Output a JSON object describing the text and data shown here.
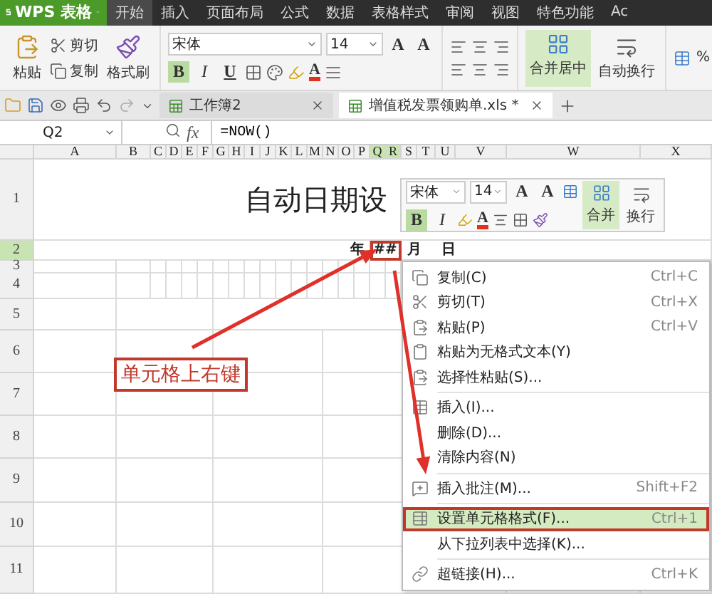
{
  "app_menu": {
    "label": "WPS 表格"
  },
  "menu_tabs": [
    {
      "label": "开始",
      "selected": true
    },
    {
      "label": "插入",
      "selected": false
    },
    {
      "label": "页面布局",
      "selected": false
    },
    {
      "label": "公式",
      "selected": false
    },
    {
      "label": "数据",
      "selected": false
    },
    {
      "label": "表格样式",
      "selected": false
    },
    {
      "label": "审阅",
      "selected": false
    },
    {
      "label": "视图",
      "selected": false
    },
    {
      "label": "特色功能",
      "selected": false
    },
    {
      "label": "Ac",
      "selected": false
    }
  ],
  "ribbon": {
    "paste": "粘贴",
    "cut": "剪切",
    "copy": "复制",
    "format_painter": "格式刷",
    "font": "宋体",
    "size": "14",
    "grow": "A",
    "shrink": "A",
    "bold": "B",
    "italic": "I",
    "underline": "U",
    "font_color": "A",
    "bold_on": true,
    "merge": "合并居中",
    "wrap": "自动换行",
    "percent": "%"
  },
  "doc_tabs": [
    {
      "title": "工作簿2",
      "selected": false
    },
    {
      "title": "增值税发票领购单.xls *",
      "selected": true
    }
  ],
  "formula_bar": {
    "cell": "Q2",
    "fx": "fx",
    "formula": "=NOW()"
  },
  "columns": [
    {
      "label": "A",
      "selected": false
    },
    {
      "label": "B",
      "selected": false
    },
    {
      "label": "C",
      "selected": false
    },
    {
      "label": "D",
      "selected": false
    },
    {
      "label": "E",
      "selected": false
    },
    {
      "label": "F",
      "selected": false
    },
    {
      "label": "G",
      "selected": false
    },
    {
      "label": "H",
      "selected": false
    },
    {
      "label": "I",
      "selected": false
    },
    {
      "label": "J",
      "selected": false
    },
    {
      "label": "K",
      "selected": false
    },
    {
      "label": "L",
      "selected": false
    },
    {
      "label": "M",
      "selected": false
    },
    {
      "label": "N",
      "selected": false
    },
    {
      "label": "O",
      "selected": false
    },
    {
      "label": "P",
      "selected": false
    },
    {
      "label": "Q",
      "selected": true
    },
    {
      "label": "R",
      "selected": true
    },
    {
      "label": "S",
      "selected": false
    },
    {
      "label": "T",
      "selected": false
    },
    {
      "label": "U",
      "selected": false
    },
    {
      "label": "V",
      "selected": false
    },
    {
      "label": "W",
      "selected": false
    },
    {
      "label": "X",
      "selected": false
    }
  ],
  "rows": [
    {
      "label": "1",
      "selected": false
    },
    {
      "label": "2",
      "selected": true
    },
    {
      "label": "3",
      "selected": false
    },
    {
      "label": "4",
      "selected": false
    },
    {
      "label": "5",
      "selected": false
    },
    {
      "label": "6",
      "selected": false
    },
    {
      "label": "7",
      "selected": false
    },
    {
      "label": "8",
      "selected": false
    },
    {
      "label": "9",
      "selected": false
    },
    {
      "label": "10",
      "selected": false
    },
    {
      "label": "11",
      "selected": false
    }
  ],
  "cells": {
    "title": "自动日期设",
    "year": "年",
    "value": "##",
    "month": "月",
    "day": "日"
  },
  "mini_toolbar": {
    "font": "宋体",
    "size": "14",
    "grow": "A",
    "shrink": "A",
    "bold": "B",
    "italic": "I",
    "font_color": "A",
    "bold_on": true,
    "merge": "合并",
    "wrap": "换行"
  },
  "context_menu": [
    {
      "kind": "item",
      "label": "复制(C)",
      "shortcut": "Ctrl+C",
      "selected": false
    },
    {
      "kind": "item",
      "label": "剪切(T)",
      "shortcut": "Ctrl+X",
      "selected": false
    },
    {
      "kind": "item",
      "label": "粘贴(P)",
      "shortcut": "Ctrl+V",
      "selected": false
    },
    {
      "kind": "item",
      "label": "粘贴为无格式文本(Y)",
      "selected": false
    },
    {
      "kind": "item",
      "label": "选择性粘贴(S)...",
      "selected": false
    },
    {
      "kind": "divider"
    },
    {
      "kind": "item",
      "label": "插入(I)...",
      "selected": false
    },
    {
      "kind": "item",
      "label": "删除(D)...",
      "selected": false
    },
    {
      "kind": "item",
      "label": "清除内容(N)",
      "selected": false
    },
    {
      "kind": "divider"
    },
    {
      "kind": "item",
      "label": "插入批注(M)...",
      "shortcut": "Shift+F2",
      "selected": false
    },
    {
      "kind": "divider"
    },
    {
      "kind": "item",
      "label": "设置单元格格式(F)...",
      "shortcut": "Ctrl+1",
      "selected": true
    },
    {
      "kind": "item",
      "label": "从下拉列表中选择(K)...",
      "selected": false
    },
    {
      "kind": "divider"
    },
    {
      "kind": "item",
      "label": "超链接(H)...",
      "shortcut": "Ctrl+K",
      "selected": false
    }
  ],
  "callout": {
    "text": "单元格上右键"
  }
}
